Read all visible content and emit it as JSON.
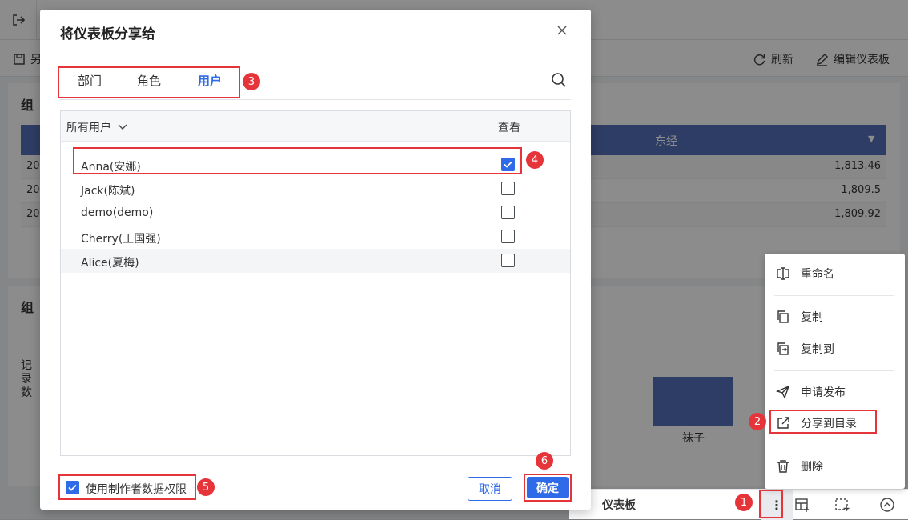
{
  "background": {
    "toolbar_left_fragment": "另",
    "refresh_label": "刷新",
    "edit_dashboard_label": "编辑仪表板",
    "card1_title_fragment": "组",
    "card2_title_fragment": "组",
    "table_header": "东经",
    "table_rows": [
      {
        "left": "20",
        "value": "1,813.46"
      },
      {
        "left": "20",
        "value": "1,809.5"
      },
      {
        "left": "20",
        "value": "1,809.92"
      }
    ],
    "chart_ylabel": "记录数",
    "chart_category": "袜子",
    "bottom_tab": "仪表板"
  },
  "context_menu": {
    "items": [
      {
        "label": "重命名",
        "icon": "rename-icon"
      },
      {
        "label": "复制",
        "icon": "copy-icon"
      },
      {
        "label": "复制到",
        "icon": "copy-to-icon"
      },
      {
        "label": "申请发布",
        "icon": "send-icon"
      },
      {
        "label": "分享到目录",
        "icon": "share-icon"
      },
      {
        "label": "删除",
        "icon": "trash-icon"
      }
    ]
  },
  "dialog": {
    "title": "将仪表板分享给",
    "tabs": [
      "部门",
      "角色",
      "用户"
    ],
    "active_tab": "用户",
    "list_header": "所有用户",
    "view_col": "查看",
    "users": [
      {
        "name": "Anna(安娜)",
        "checked": true
      },
      {
        "name": "Jack(陈斌)",
        "checked": false
      },
      {
        "name": "demo(demo)",
        "checked": false
      },
      {
        "name": "Cherry(王国强)",
        "checked": false
      },
      {
        "name": "Alice(夏梅)",
        "checked": false
      }
    ],
    "use_creator_permission": "使用制作者数据权限",
    "cancel_label": "取消",
    "ok_label": "确定"
  },
  "badges": [
    "1",
    "2",
    "3",
    "4",
    "5",
    "6"
  ],
  "colors": {
    "accent": "#2f6be8",
    "annotation": "#e5343a",
    "table_header": "#5470b8"
  }
}
